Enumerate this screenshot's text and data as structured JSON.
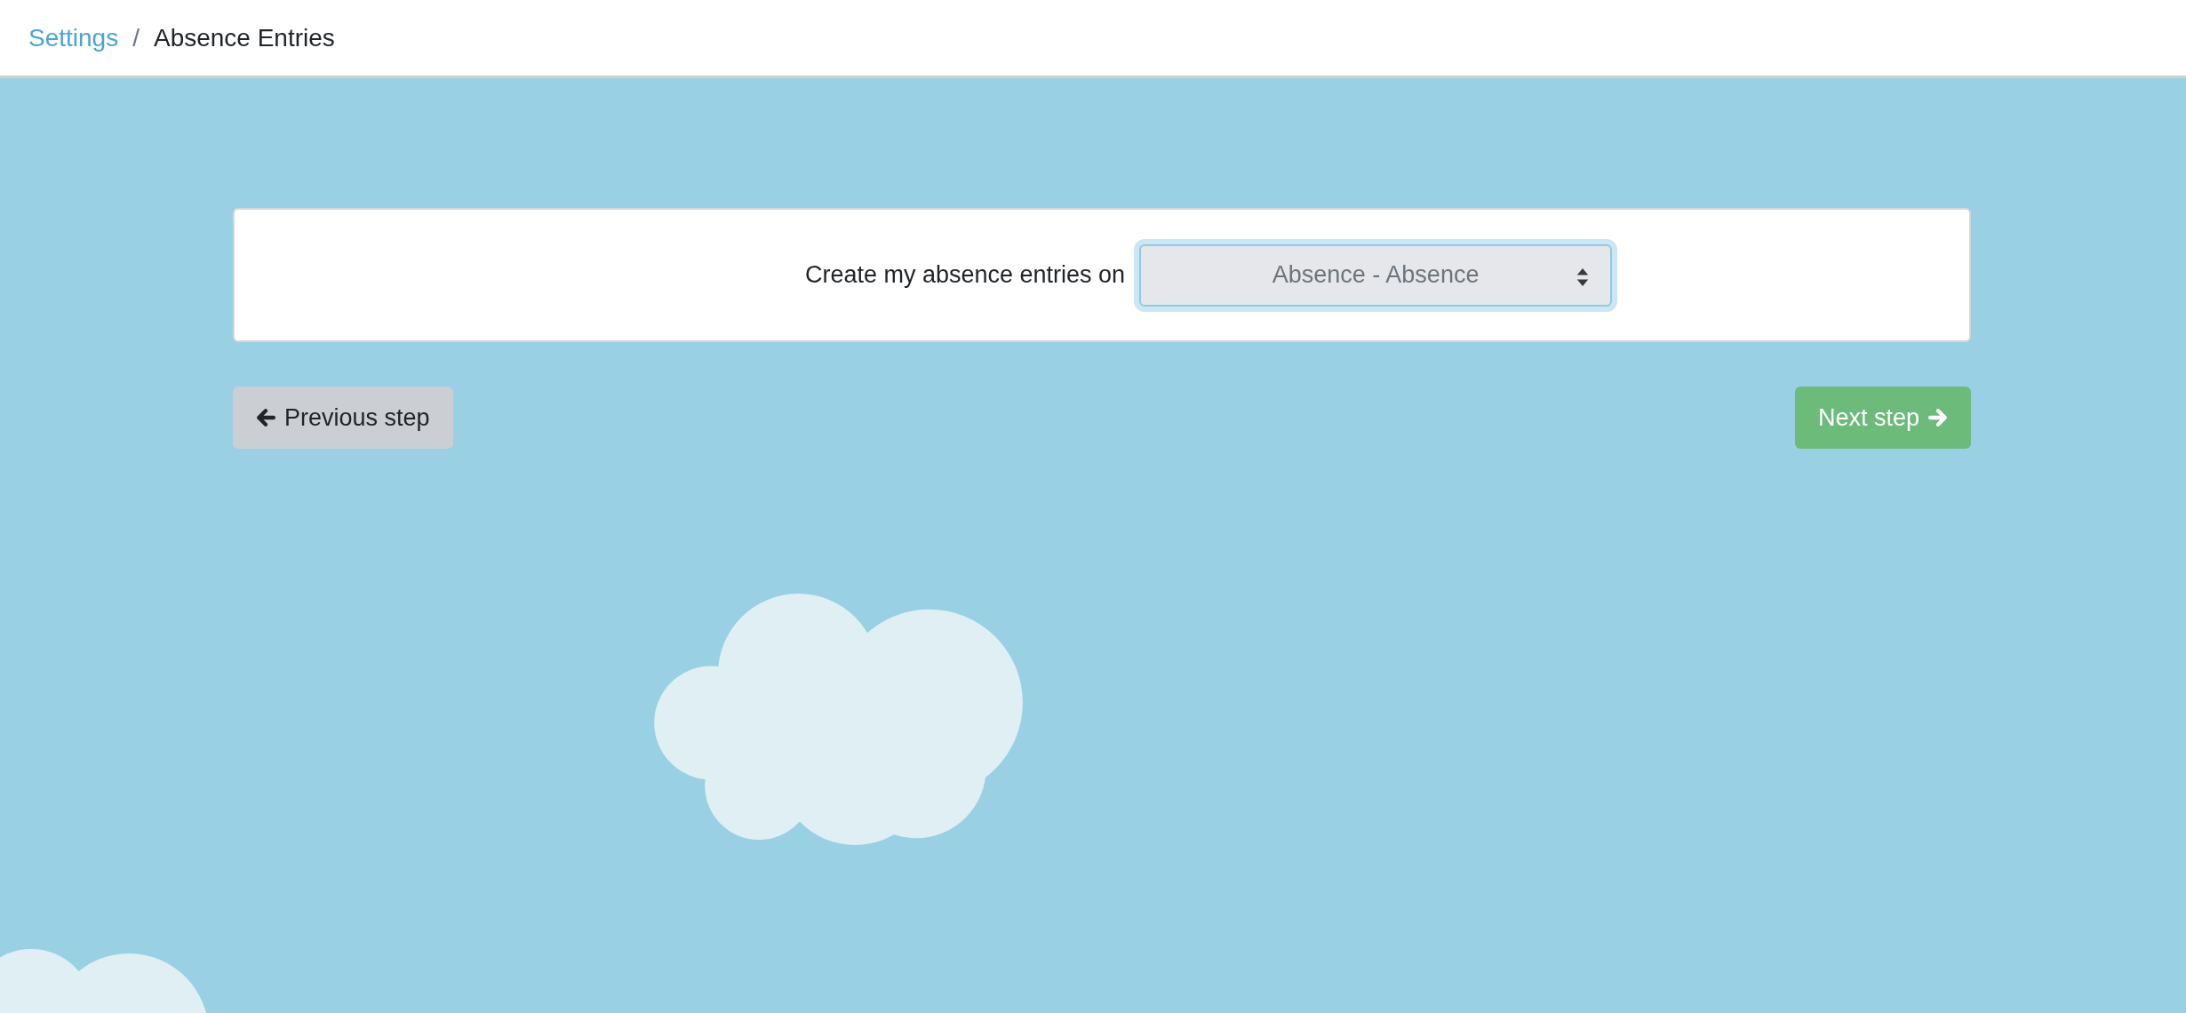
{
  "breadcrumb": {
    "items": [
      {
        "label": "Settings",
        "kind": "link"
      },
      {
        "label": "/",
        "kind": "separator"
      },
      {
        "label": "Absence Entries",
        "kind": "current"
      }
    ]
  },
  "form": {
    "label": "Create my absence entries on",
    "select": {
      "value": "Absence - Absence"
    }
  },
  "buttons": [
    {
      "label": "Previous step",
      "kind": "previous"
    },
    {
      "label": "Next step",
      "kind": "next"
    }
  ]
}
